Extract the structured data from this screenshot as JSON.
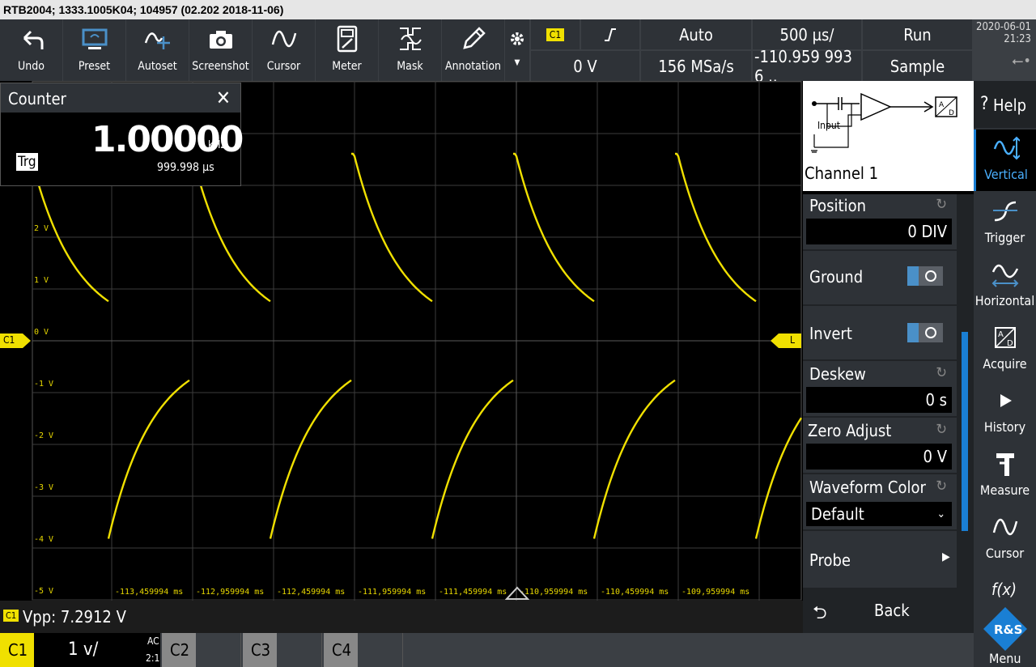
{
  "title": "RTB2004; 1333.1005K04; 104957 (02.202 2018-11-06)",
  "toolbar": {
    "tools": [
      {
        "label": "Undo",
        "icon": "undo-icon"
      },
      {
        "label": "Preset",
        "icon": "preset-icon"
      },
      {
        "label": "Autoset",
        "icon": "autoset-icon"
      },
      {
        "label": "Screenshot",
        "icon": "camera-icon"
      },
      {
        "label": "Cursor",
        "icon": "cursor-icon"
      },
      {
        "label": "Meter",
        "icon": "meter-icon"
      },
      {
        "label": "Mask",
        "icon": "mask-icon"
      },
      {
        "label": "Annotation",
        "icon": "pencil-icon"
      }
    ],
    "trigger_source": "C1",
    "trigger_level": "0 V",
    "trigger_mode": "Auto",
    "sample_rate": "156 MSa/s",
    "timebase": "500 µs/",
    "position": "-110.959 993 6 ..",
    "run_state": "Run",
    "acq_mode": "Sample",
    "date": "2020-06-01",
    "time": "21:23"
  },
  "counter": {
    "title": "Counter",
    "frequency": "1.00000",
    "frequency_unit": "kHz",
    "period": "999.998 µs",
    "trigger_badge": "Trg"
  },
  "waveform": {
    "y_labels": [
      "2 V",
      "1 V",
      "0 V",
      "-1 V",
      "-2 V",
      "-3 V",
      "-4 V",
      "-5 V"
    ],
    "x_labels": [
      "-113,459994 ms",
      "-112,959994 ms",
      "-112,459994 ms",
      "-111,959994 ms",
      "-111,459994 ms",
      "-110,959994 ms",
      "-110,459994 ms",
      "-109,959994 ms"
    ],
    "channel_marker": "C1",
    "trigger_marker": "L",
    "color": "#f0e000"
  },
  "channel_panel": {
    "name": "Channel 1",
    "input_label": "Input",
    "position_label": "Position",
    "position_value": "0 DIV",
    "ground_label": "Ground",
    "invert_label": "Invert",
    "deskew_label": "Deskew",
    "deskew_value": "0 s",
    "zero_adjust_label": "Zero Adjust",
    "zero_adjust_value": "0 V",
    "waveform_color_label": "Waveform Color",
    "waveform_color_value": "Default",
    "probe_label": "Probe",
    "back_label": "Back"
  },
  "sidebar": {
    "help": "Help",
    "items": [
      {
        "label": "Vertical",
        "icon": "vertical-icon"
      },
      {
        "label": "Trigger",
        "icon": "trigger-icon"
      },
      {
        "label": "Horizontal",
        "icon": "horizontal-icon"
      },
      {
        "label": "Acquire",
        "icon": "acquire-icon"
      },
      {
        "label": "History",
        "icon": "play-icon"
      },
      {
        "label": "Measure",
        "icon": "caliper-icon"
      },
      {
        "label": "Cursor",
        "icon": "cursor-icon"
      }
    ],
    "fx": "f(x)",
    "menu": "Menu",
    "logo": "R&S"
  },
  "status": {
    "badge": "C1",
    "measurement": "Vpp: 7.2912 V"
  },
  "channels": {
    "c1": {
      "label": "C1",
      "scale": "1 v/",
      "coupling": "AC",
      "ratio": "2:1"
    },
    "c2": {
      "label": "C2"
    },
    "c3": {
      "label": "C3"
    },
    "c4": {
      "label": "C4"
    }
  }
}
